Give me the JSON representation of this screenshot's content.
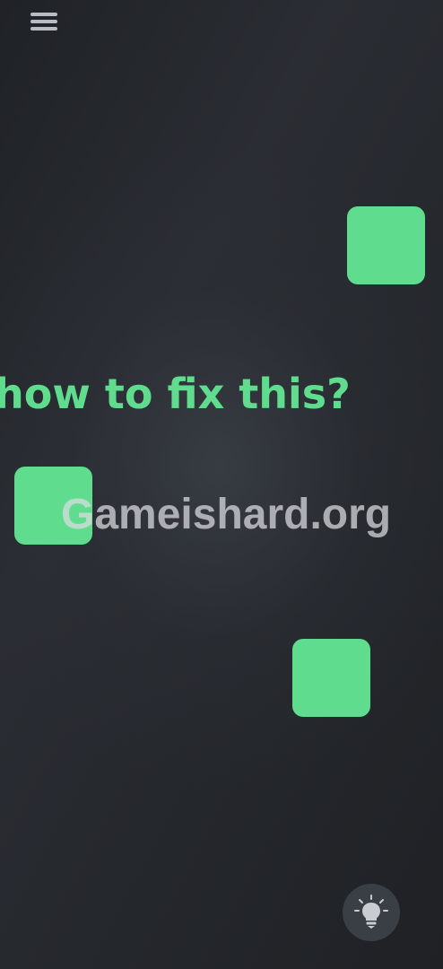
{
  "app": {
    "question": "how to fix this?",
    "watermark": "Gameishard.org"
  },
  "icons": {
    "menu": "hamburger-menu-icon",
    "hint": "lightbulb-icon"
  },
  "colors": {
    "accent": "#5fdc8e",
    "background": "#25282d",
    "icon": "#b9bcc2",
    "hint_button_bg": "#3a3e45"
  },
  "tiles_count": 3
}
